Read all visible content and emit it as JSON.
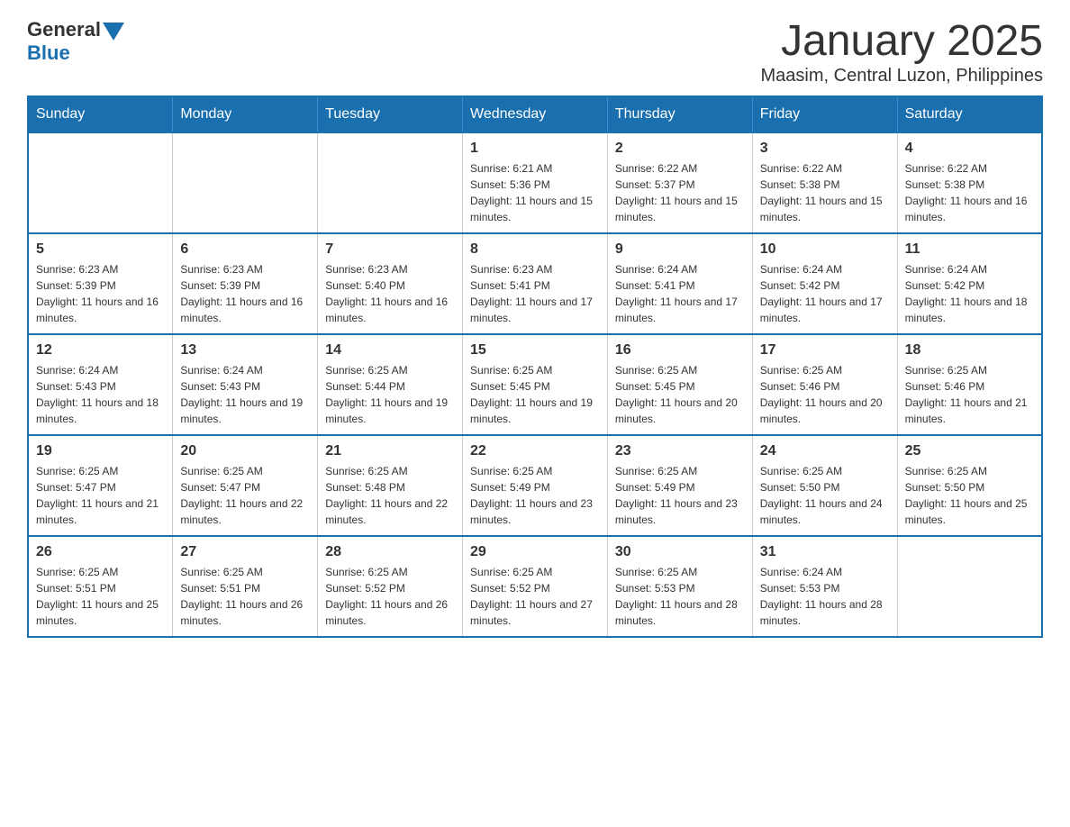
{
  "logo": {
    "text_general": "General",
    "text_blue": "Blue"
  },
  "header": {
    "month_title": "January 2025",
    "location": "Maasim, Central Luzon, Philippines"
  },
  "days_of_week": [
    "Sunday",
    "Monday",
    "Tuesday",
    "Wednesday",
    "Thursday",
    "Friday",
    "Saturday"
  ],
  "weeks": [
    [
      {
        "day": "",
        "sunrise": "",
        "sunset": "",
        "daylight": ""
      },
      {
        "day": "",
        "sunrise": "",
        "sunset": "",
        "daylight": ""
      },
      {
        "day": "",
        "sunrise": "",
        "sunset": "",
        "daylight": ""
      },
      {
        "day": "1",
        "sunrise": "Sunrise: 6:21 AM",
        "sunset": "Sunset: 5:36 PM",
        "daylight": "Daylight: 11 hours and 15 minutes."
      },
      {
        "day": "2",
        "sunrise": "Sunrise: 6:22 AM",
        "sunset": "Sunset: 5:37 PM",
        "daylight": "Daylight: 11 hours and 15 minutes."
      },
      {
        "day": "3",
        "sunrise": "Sunrise: 6:22 AM",
        "sunset": "Sunset: 5:38 PM",
        "daylight": "Daylight: 11 hours and 15 minutes."
      },
      {
        "day": "4",
        "sunrise": "Sunrise: 6:22 AM",
        "sunset": "Sunset: 5:38 PM",
        "daylight": "Daylight: 11 hours and 16 minutes."
      }
    ],
    [
      {
        "day": "5",
        "sunrise": "Sunrise: 6:23 AM",
        "sunset": "Sunset: 5:39 PM",
        "daylight": "Daylight: 11 hours and 16 minutes."
      },
      {
        "day": "6",
        "sunrise": "Sunrise: 6:23 AM",
        "sunset": "Sunset: 5:39 PM",
        "daylight": "Daylight: 11 hours and 16 minutes."
      },
      {
        "day": "7",
        "sunrise": "Sunrise: 6:23 AM",
        "sunset": "Sunset: 5:40 PM",
        "daylight": "Daylight: 11 hours and 16 minutes."
      },
      {
        "day": "8",
        "sunrise": "Sunrise: 6:23 AM",
        "sunset": "Sunset: 5:41 PM",
        "daylight": "Daylight: 11 hours and 17 minutes."
      },
      {
        "day": "9",
        "sunrise": "Sunrise: 6:24 AM",
        "sunset": "Sunset: 5:41 PM",
        "daylight": "Daylight: 11 hours and 17 minutes."
      },
      {
        "day": "10",
        "sunrise": "Sunrise: 6:24 AM",
        "sunset": "Sunset: 5:42 PM",
        "daylight": "Daylight: 11 hours and 17 minutes."
      },
      {
        "day": "11",
        "sunrise": "Sunrise: 6:24 AM",
        "sunset": "Sunset: 5:42 PM",
        "daylight": "Daylight: 11 hours and 18 minutes."
      }
    ],
    [
      {
        "day": "12",
        "sunrise": "Sunrise: 6:24 AM",
        "sunset": "Sunset: 5:43 PM",
        "daylight": "Daylight: 11 hours and 18 minutes."
      },
      {
        "day": "13",
        "sunrise": "Sunrise: 6:24 AM",
        "sunset": "Sunset: 5:43 PM",
        "daylight": "Daylight: 11 hours and 19 minutes."
      },
      {
        "day": "14",
        "sunrise": "Sunrise: 6:25 AM",
        "sunset": "Sunset: 5:44 PM",
        "daylight": "Daylight: 11 hours and 19 minutes."
      },
      {
        "day": "15",
        "sunrise": "Sunrise: 6:25 AM",
        "sunset": "Sunset: 5:45 PM",
        "daylight": "Daylight: 11 hours and 19 minutes."
      },
      {
        "day": "16",
        "sunrise": "Sunrise: 6:25 AM",
        "sunset": "Sunset: 5:45 PM",
        "daylight": "Daylight: 11 hours and 20 minutes."
      },
      {
        "day": "17",
        "sunrise": "Sunrise: 6:25 AM",
        "sunset": "Sunset: 5:46 PM",
        "daylight": "Daylight: 11 hours and 20 minutes."
      },
      {
        "day": "18",
        "sunrise": "Sunrise: 6:25 AM",
        "sunset": "Sunset: 5:46 PM",
        "daylight": "Daylight: 11 hours and 21 minutes."
      }
    ],
    [
      {
        "day": "19",
        "sunrise": "Sunrise: 6:25 AM",
        "sunset": "Sunset: 5:47 PM",
        "daylight": "Daylight: 11 hours and 21 minutes."
      },
      {
        "day": "20",
        "sunrise": "Sunrise: 6:25 AM",
        "sunset": "Sunset: 5:47 PM",
        "daylight": "Daylight: 11 hours and 22 minutes."
      },
      {
        "day": "21",
        "sunrise": "Sunrise: 6:25 AM",
        "sunset": "Sunset: 5:48 PM",
        "daylight": "Daylight: 11 hours and 22 minutes."
      },
      {
        "day": "22",
        "sunrise": "Sunrise: 6:25 AM",
        "sunset": "Sunset: 5:49 PM",
        "daylight": "Daylight: 11 hours and 23 minutes."
      },
      {
        "day": "23",
        "sunrise": "Sunrise: 6:25 AM",
        "sunset": "Sunset: 5:49 PM",
        "daylight": "Daylight: 11 hours and 23 minutes."
      },
      {
        "day": "24",
        "sunrise": "Sunrise: 6:25 AM",
        "sunset": "Sunset: 5:50 PM",
        "daylight": "Daylight: 11 hours and 24 minutes."
      },
      {
        "day": "25",
        "sunrise": "Sunrise: 6:25 AM",
        "sunset": "Sunset: 5:50 PM",
        "daylight": "Daylight: 11 hours and 25 minutes."
      }
    ],
    [
      {
        "day": "26",
        "sunrise": "Sunrise: 6:25 AM",
        "sunset": "Sunset: 5:51 PM",
        "daylight": "Daylight: 11 hours and 25 minutes."
      },
      {
        "day": "27",
        "sunrise": "Sunrise: 6:25 AM",
        "sunset": "Sunset: 5:51 PM",
        "daylight": "Daylight: 11 hours and 26 minutes."
      },
      {
        "day": "28",
        "sunrise": "Sunrise: 6:25 AM",
        "sunset": "Sunset: 5:52 PM",
        "daylight": "Daylight: 11 hours and 26 minutes."
      },
      {
        "day": "29",
        "sunrise": "Sunrise: 6:25 AM",
        "sunset": "Sunset: 5:52 PM",
        "daylight": "Daylight: 11 hours and 27 minutes."
      },
      {
        "day": "30",
        "sunrise": "Sunrise: 6:25 AM",
        "sunset": "Sunset: 5:53 PM",
        "daylight": "Daylight: 11 hours and 28 minutes."
      },
      {
        "day": "31",
        "sunrise": "Sunrise: 6:24 AM",
        "sunset": "Sunset: 5:53 PM",
        "daylight": "Daylight: 11 hours and 28 minutes."
      },
      {
        "day": "",
        "sunrise": "",
        "sunset": "",
        "daylight": ""
      }
    ]
  ]
}
